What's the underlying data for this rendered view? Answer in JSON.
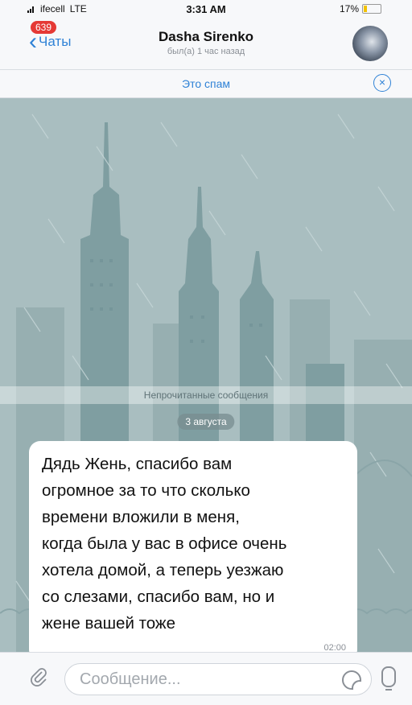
{
  "status_bar": {
    "carrier": "ifecell",
    "network": "LTE",
    "time": "3:31 AM",
    "battery": "17%"
  },
  "nav": {
    "back_label": "Чаты",
    "unread_count": "639",
    "contact_name": "Dasha Sirenko",
    "last_seen": "был(а) 1 час назад"
  },
  "spam_bar": {
    "label": "Это спам",
    "close_icon": "close-icon"
  },
  "chat": {
    "unread_divider": "Непрочитанные сообщения",
    "date_label": "3 августа",
    "message": {
      "text": "Дядь Жень, спасибо вам\nогромное за то что сколько\nвремени вложили в меня,\nкогда была у вас в офисе очень\nхотела домой, а теперь уезжаю\nсо слезами, спасибо вам, но и\nжене вашей тоже",
      "time": "02:00"
    }
  },
  "input": {
    "placeholder": "Сообщение..."
  },
  "colors": {
    "accent": "#2f82d6",
    "badge": "#e53935",
    "wallpaper": "#a9bec0"
  }
}
